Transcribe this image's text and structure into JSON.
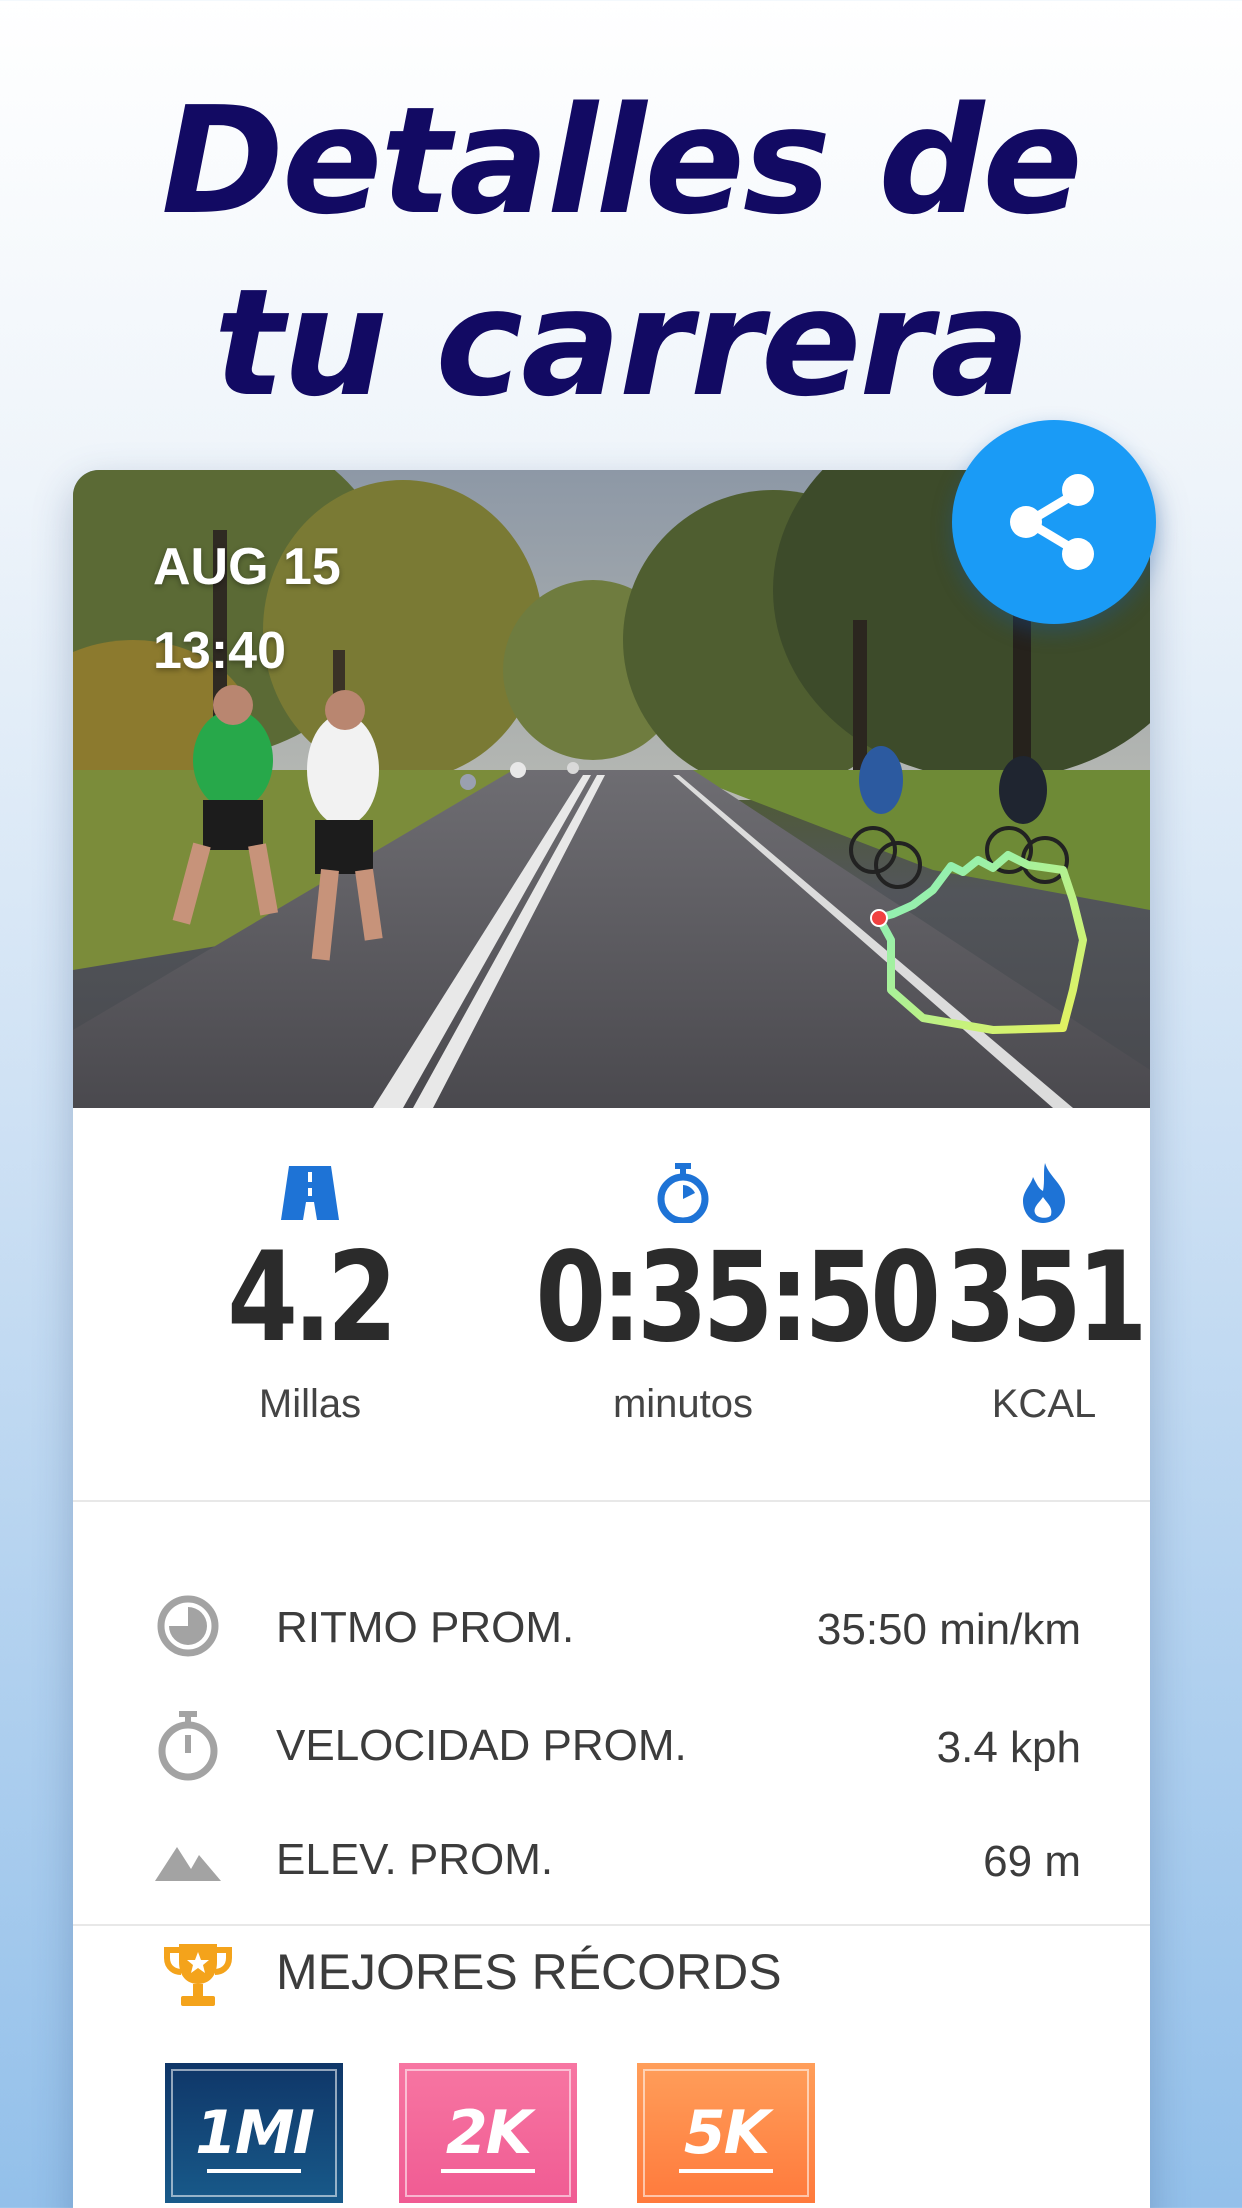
{
  "headline": {
    "line1": "Detalles de",
    "line2": "tu carrera"
  },
  "photo": {
    "date": "AUG 15",
    "time": "13:40"
  },
  "share": {
    "icon": "share-icon",
    "color": "#1a9bf6"
  },
  "stats": [
    {
      "icon": "road-icon",
      "value": "4.2",
      "unit": "Millas"
    },
    {
      "icon": "stopwatch-icon",
      "value": "0:35:50",
      "unit": "minutos"
    },
    {
      "icon": "flame-icon",
      "value": "351",
      "unit": "KCAL"
    }
  ],
  "metrics": [
    {
      "icon": "pace-icon",
      "label": "RITMO PROM.",
      "value": "35:50 min/km"
    },
    {
      "icon": "timer-icon",
      "label": "VELOCIDAD PROM.",
      "value": "3.4 kph"
    },
    {
      "icon": "mountain-icon",
      "label": "ELEV. PROM.",
      "value": "69 m"
    }
  ],
  "records": {
    "title": "MEJORES RÉCORDS",
    "badges": [
      "1MI",
      "2K",
      "5K"
    ]
  },
  "colors": {
    "headline": "#120a63",
    "accent_blue": "#1e73d6",
    "badge_1mi": "#0f3668",
    "badge_2k": "#f05b93",
    "badge_5k": "#ff7a3c",
    "trophy": "#f4a31b"
  }
}
